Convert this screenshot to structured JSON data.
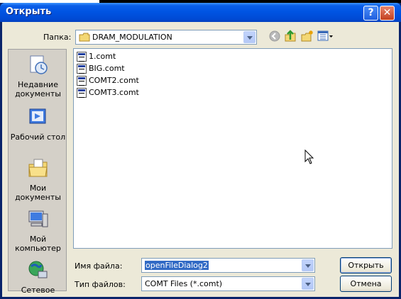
{
  "window": {
    "title": "Открыть"
  },
  "toolbar": {
    "folder_label": "Папка:",
    "folder_value": "DRAM_MODULATION"
  },
  "places": [
    {
      "label": "Недавние документы",
      "icon": "recent-documents-icon"
    },
    {
      "label": "Рабочий стол",
      "icon": "desktop-icon"
    },
    {
      "label": "Мои документы",
      "icon": "my-documents-icon"
    },
    {
      "label": "Мой компьютер",
      "icon": "my-computer-icon"
    },
    {
      "label": "Сетевое",
      "icon": "network-icon"
    }
  ],
  "files": [
    {
      "name": "1.comt"
    },
    {
      "name": "BIG.comt"
    },
    {
      "name": "COMT2.comt"
    },
    {
      "name": "COMT3.comt"
    }
  ],
  "filename": {
    "label": "Имя файла:",
    "value": "openFileDialog2"
  },
  "filetype": {
    "label": "Тип файлов:",
    "value": "COMT Files (*.comt)"
  },
  "buttons": {
    "open": "Открыть",
    "cancel": "Отмена"
  },
  "colors": {
    "titlebar": "#0054e3",
    "dialog_bg": "#ece9d8",
    "selection": "#316ac5"
  }
}
